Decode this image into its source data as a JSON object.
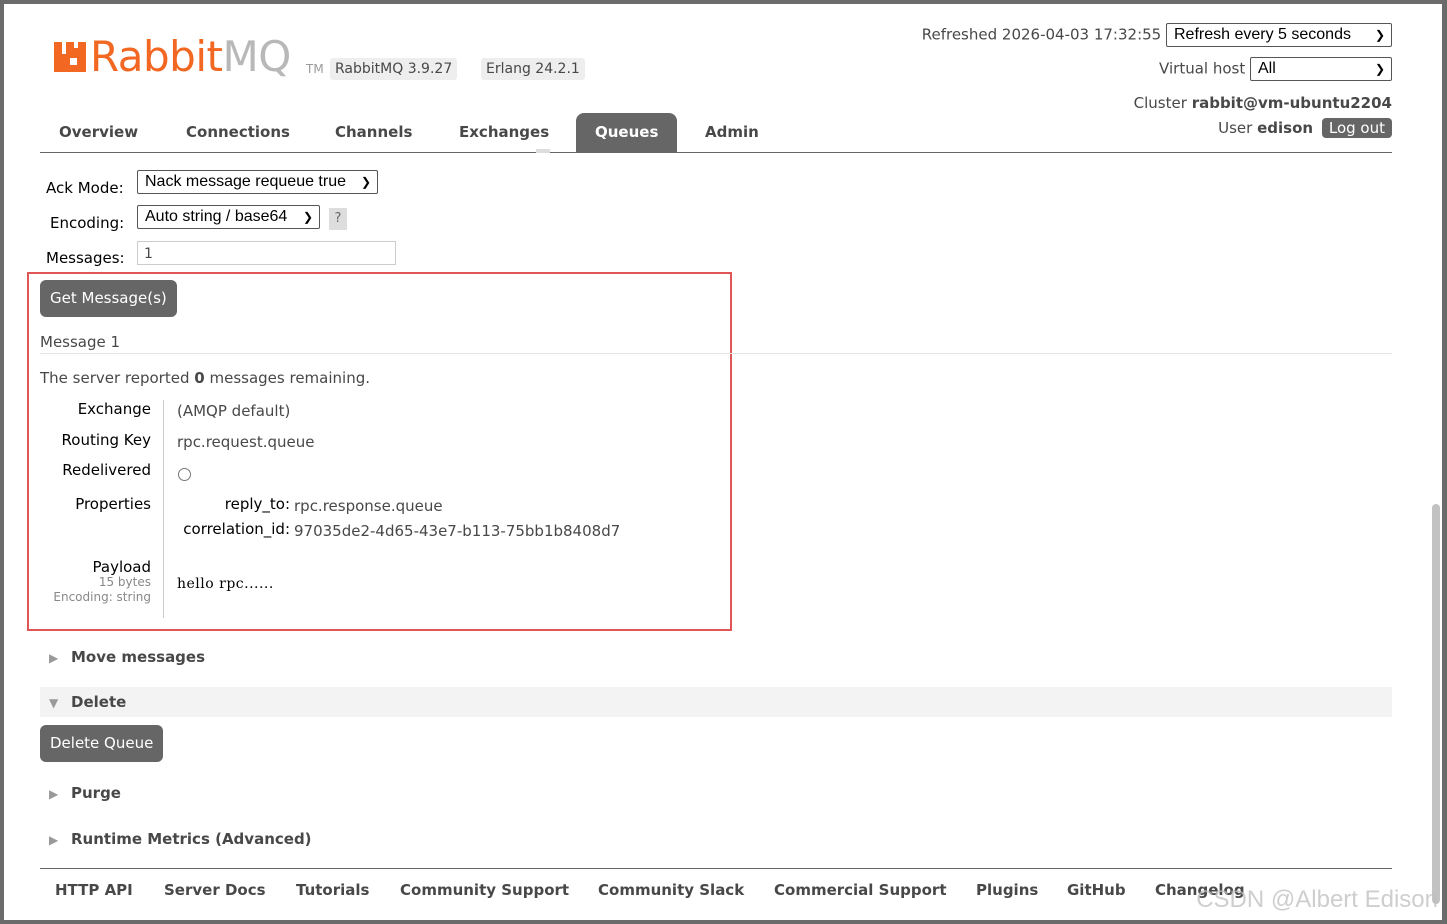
{
  "header": {
    "logo_text_main": "Rabbit",
    "logo_text_mq": "MQ",
    "logo_tm": "TM",
    "rabbitmq_version": "RabbitMQ 3.9.27",
    "erlang_version": "Erlang 24.2.1",
    "refreshed_label": "Refreshed 2026-04-03 17:32:55",
    "refresh_select": "Refresh every 5 seconds",
    "vhost_label": "Virtual host",
    "vhost_select": "All",
    "cluster_label": "Cluster",
    "cluster_name": "rabbit@vm-ubuntu2204",
    "user_label": "User",
    "user_name": "edison",
    "logout_label": "Log out"
  },
  "tabs": [
    {
      "label": "Overview"
    },
    {
      "label": "Connections"
    },
    {
      "label": "Channels"
    },
    {
      "label": "Exchanges"
    },
    {
      "label": "Queues",
      "active": true
    },
    {
      "label": "Admin"
    }
  ],
  "get_messages": {
    "ack_mode_label": "Ack Mode:",
    "ack_mode_value": "Nack message requeue true",
    "encoding_label": "Encoding:",
    "encoding_value": "Auto string / base64",
    "help_label": "?",
    "messages_label": "Messages:",
    "messages_value": "1",
    "get_button": "Get Message(s)"
  },
  "message": {
    "title": "Message 1",
    "server_reported_prefix": "The server reported",
    "remaining_count": "0",
    "server_reported_suffix": "messages remaining.",
    "exchange_label": "Exchange",
    "exchange_value": "(AMQP default)",
    "routing_key_label": "Routing Key",
    "routing_key_value": "rpc.request.queue",
    "redelivered_label": "Redelivered",
    "properties_label": "Properties",
    "reply_to_label": "reply_to:",
    "reply_to_value": "rpc.response.queue",
    "correlation_id_label": "correlation_id:",
    "correlation_id_value": "97035de2-4d65-43e7-b113-75bb1b8408d7",
    "payload_label": "Payload",
    "payload_bytes": "15 bytes",
    "payload_encoding": "Encoding: string",
    "payload_value": "hello rpc......"
  },
  "sections": {
    "move": "Move messages",
    "delete": "Delete",
    "delete_button": "Delete Queue",
    "purge": "Purge",
    "runtime": "Runtime Metrics (Advanced)"
  },
  "footer": {
    "links": [
      "HTTP API",
      "Server Docs",
      "Tutorials",
      "Community Support",
      "Community Slack",
      "Commercial Support",
      "Plugins",
      "GitHub",
      "Changelog"
    ]
  },
  "watermark": "CSDN @Albert Edison",
  "colors": {
    "brand_orange": "#f26722",
    "tab_active": "#666666",
    "highlight_red": "#e05555"
  }
}
